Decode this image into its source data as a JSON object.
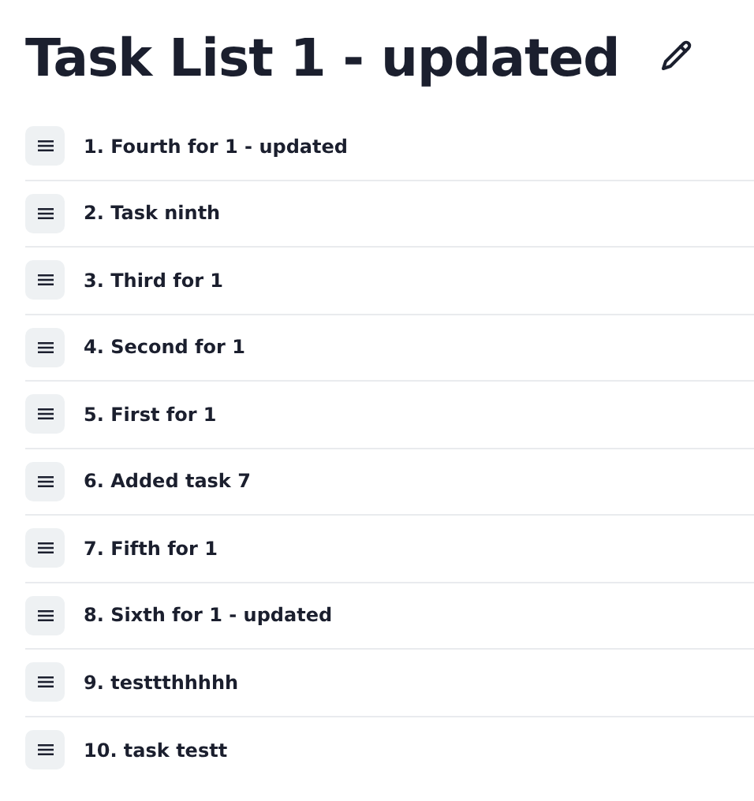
{
  "title": "Task List 1 - updated",
  "tasks": [
    {
      "label": "1. Fourth for 1 - updated"
    },
    {
      "label": "2. Task ninth"
    },
    {
      "label": "3. Third for 1"
    },
    {
      "label": "4. Second for 1"
    },
    {
      "label": "5. First for 1"
    },
    {
      "label": "6. Added task 7"
    },
    {
      "label": "7. Fifth for 1"
    },
    {
      "label": "8. Sixth for 1 - updated"
    },
    {
      "label": "9. testtthhhhh"
    },
    {
      "label": "10. task testt"
    }
  ]
}
